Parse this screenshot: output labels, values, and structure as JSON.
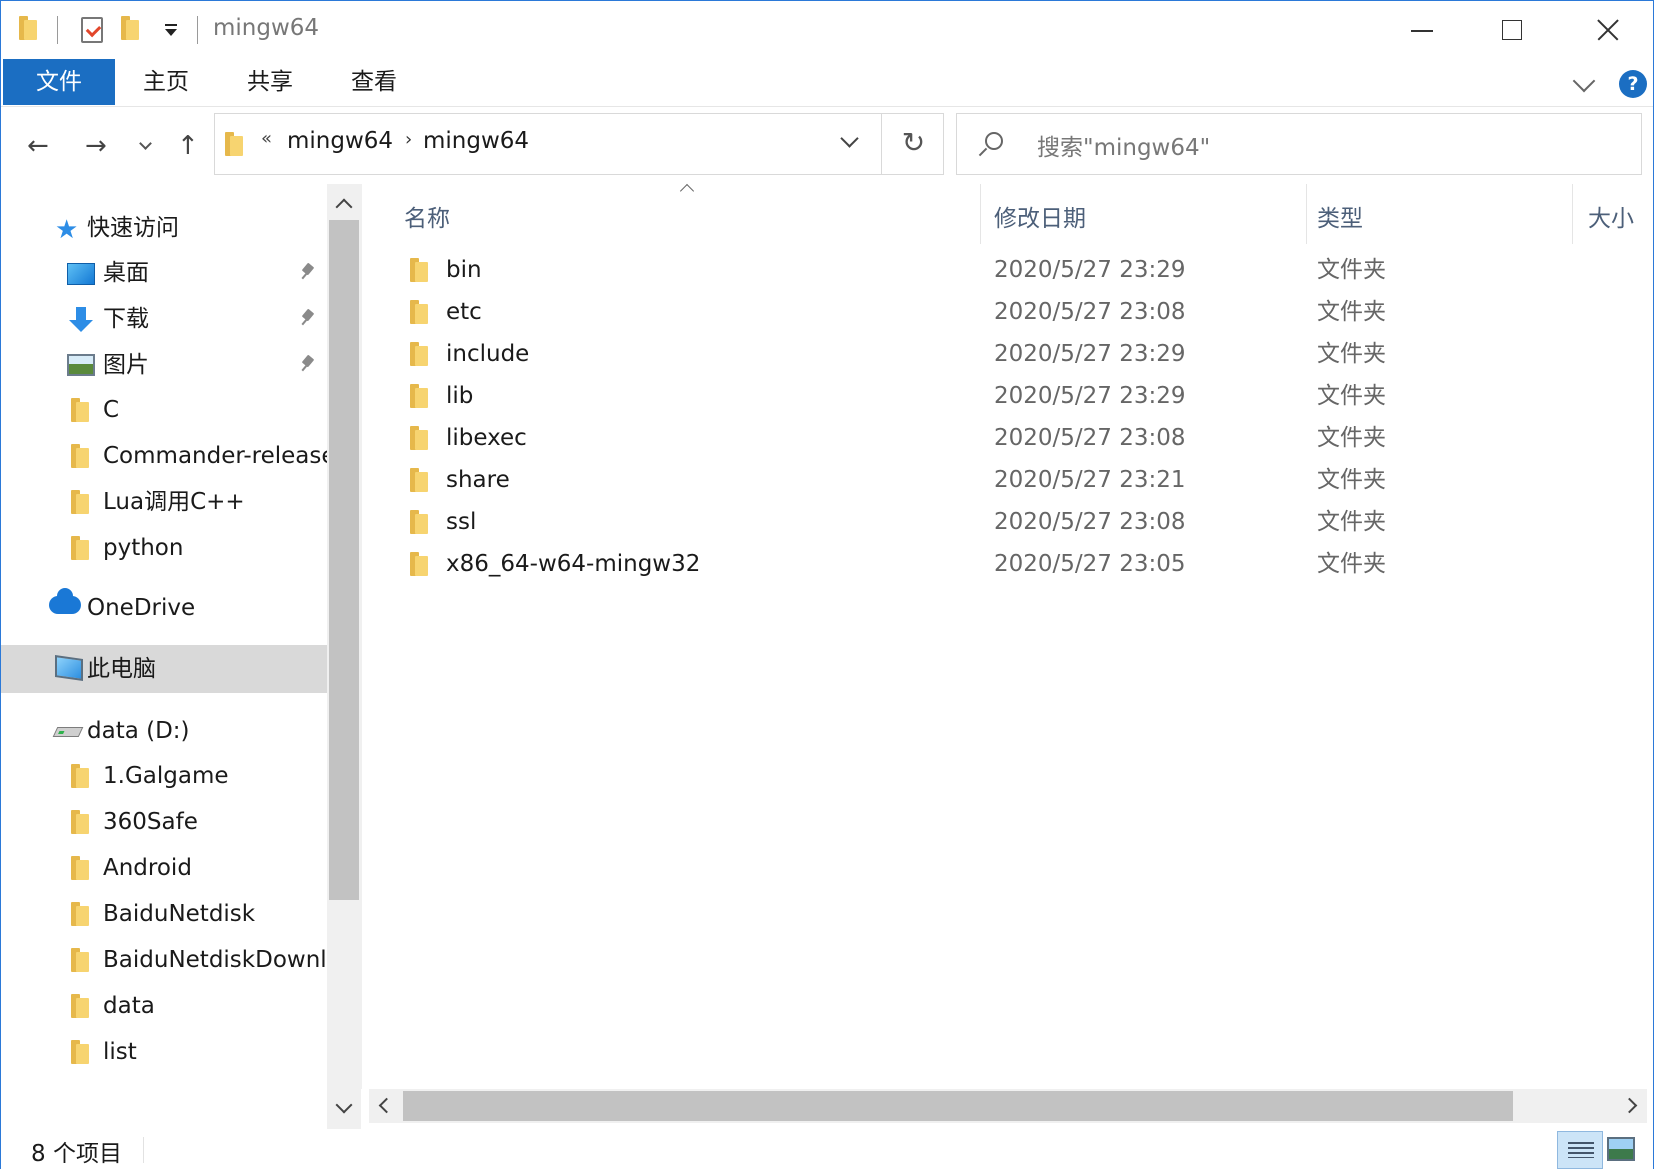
{
  "window": {
    "title": "mingw64",
    "buttons": [
      "minimize",
      "maximize",
      "close"
    ]
  },
  "ribbon": {
    "tabs": [
      {
        "label": "文件",
        "active": true
      },
      {
        "label": "主页",
        "active": false
      },
      {
        "label": "共享",
        "active": false
      },
      {
        "label": "查看",
        "active": false
      }
    ],
    "help_label": "?"
  },
  "address": {
    "overflow_glyph": "«",
    "crumbs": [
      "mingw64",
      "mingw64"
    ],
    "separator": "›",
    "refresh_glyph": "↻"
  },
  "search": {
    "placeholder": "搜索\"mingw64\""
  },
  "nav": {
    "back": "←",
    "forward": "→",
    "up": "↑"
  },
  "navpane": {
    "quick_access": "快速访问",
    "pinned": [
      {
        "label": "桌面",
        "icon": "desktop-icon"
      },
      {
        "label": "下载",
        "icon": "download-icon"
      },
      {
        "label": "图片",
        "icon": "pictures-icon"
      }
    ],
    "quick_folders": [
      "C",
      "Commander-release",
      "Lua调用C++",
      "python"
    ],
    "onedrive": "OneDrive",
    "this_pc": "此电脑",
    "drive": "data (D:)",
    "drive_folders": [
      "1.Galgame",
      "360Safe",
      "Android",
      "BaiduNetdisk",
      "BaiduNetdiskDownl",
      "data",
      "list"
    ]
  },
  "columns": {
    "name": "名称",
    "date": "修改日期",
    "type": "类型",
    "size": "大小"
  },
  "files": [
    {
      "name": "bin",
      "date": "2020/5/27 23:29",
      "type": "文件夹"
    },
    {
      "name": "etc",
      "date": "2020/5/27 23:08",
      "type": "文件夹"
    },
    {
      "name": "include",
      "date": "2020/5/27 23:29",
      "type": "文件夹"
    },
    {
      "name": "lib",
      "date": "2020/5/27 23:29",
      "type": "文件夹"
    },
    {
      "name": "libexec",
      "date": "2020/5/27 23:08",
      "type": "文件夹"
    },
    {
      "name": "share",
      "date": "2020/5/27 23:21",
      "type": "文件夹"
    },
    {
      "name": "ssl",
      "date": "2020/5/27 23:08",
      "type": "文件夹"
    },
    {
      "name": "x86_64-w64-mingw32",
      "date": "2020/5/27 23:05",
      "type": "文件夹"
    }
  ],
  "status": {
    "item_count": "8 个项目"
  },
  "colors": {
    "accent": "#1b6ec2",
    "folder": "#f7d470",
    "column_header": "#4c5f79"
  }
}
